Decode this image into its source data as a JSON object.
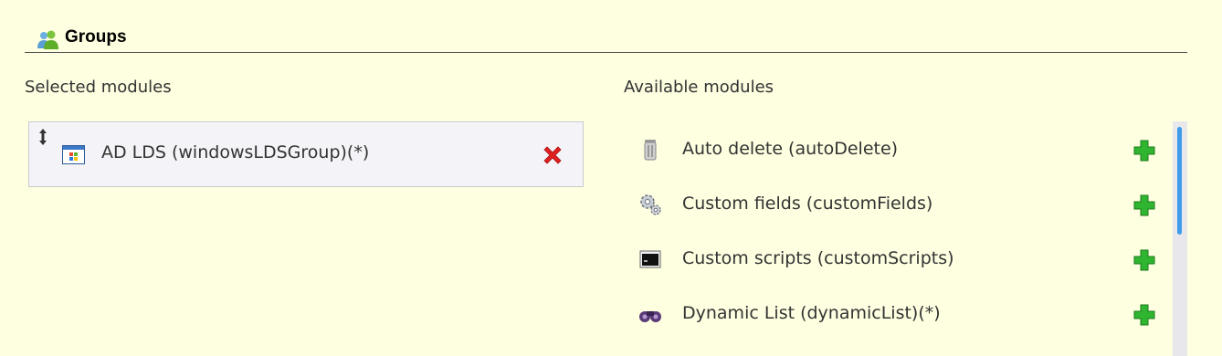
{
  "section": {
    "title": "Groups",
    "icon": "group-icon"
  },
  "selected": {
    "label": "Selected modules",
    "items": [
      {
        "label": "AD LDS (windowsLDSGroup)(*)",
        "icon": "windows-icon"
      }
    ]
  },
  "available": {
    "label": "Available modules",
    "items": [
      {
        "label": "Auto delete (autoDelete)",
        "icon": "trash-can-icon"
      },
      {
        "label": "Custom fields (customFields)",
        "icon": "gears-icon"
      },
      {
        "label": "Custom scripts (customScripts)",
        "icon": "terminal-icon"
      },
      {
        "label": "Dynamic List (dynamicList)(*)",
        "icon": "binoculars-icon"
      }
    ]
  },
  "colors": {
    "background": "#fefee0",
    "remove": "#e02020",
    "add": "#2fb52f",
    "scrollbar": "#3d9be8"
  }
}
